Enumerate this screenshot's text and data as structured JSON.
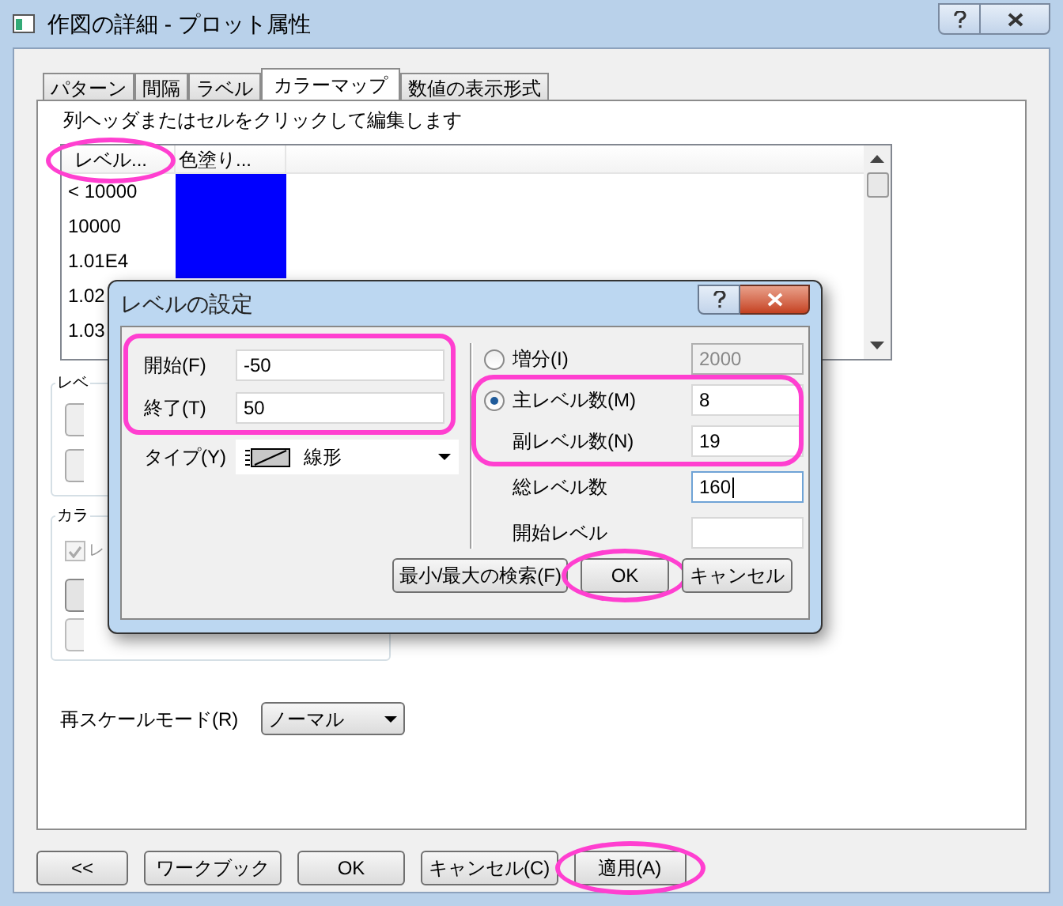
{
  "window": {
    "title": "作図の詳細 - プロット属性"
  },
  "tabs": [
    {
      "label": "パターン",
      "selected": false
    },
    {
      "label": "間隔",
      "selected": false
    },
    {
      "label": "ラベル",
      "selected": false
    },
    {
      "label": "カラーマップ",
      "selected": true
    },
    {
      "label": "数値の表示形式",
      "selected": false
    }
  ],
  "colormap": {
    "hint": "列ヘッダまたはセルをクリックして編集します",
    "columns": [
      {
        "label": "レベル...",
        "highlighted": true
      },
      {
        "label": "色塗り...",
        "highlighted": false
      }
    ],
    "rows": [
      {
        "level": "< 10000",
        "color": "#0000ff"
      },
      {
        "level": "10000",
        "color": "#0000ff"
      },
      {
        "level": "1.01E4",
        "color": "#0000ff"
      },
      {
        "level": "1.02"
      },
      {
        "level": "1.03"
      }
    ]
  },
  "level_group": {
    "label": "レベ"
  },
  "color_group": {
    "label": "カラ",
    "checkbox": {
      "label": "レ",
      "checked": true,
      "disabled": true
    }
  },
  "rescale": {
    "label": "再スケールモード(R)",
    "value": "ノーマル"
  },
  "buttons": [
    {
      "label": "<<",
      "highlighted": false
    },
    {
      "label": "ワークブック",
      "highlighted": false
    },
    {
      "label": "OK",
      "highlighted": false
    },
    {
      "label": "キャンセル(C)",
      "highlighted": false
    },
    {
      "label": "適用(A)",
      "highlighted": true
    }
  ],
  "level_dialog": {
    "title": "レベルの設定",
    "range": {
      "highlighted": true,
      "fields": [
        {
          "label": "開始(F)",
          "value": "-50"
        },
        {
          "label": "終了(T)",
          "value": "50"
        }
      ]
    },
    "type": {
      "label": "タイプ(Y)",
      "value": "線形"
    },
    "increment": {
      "label": "増分(I)",
      "selected": false,
      "value": "2000",
      "disabled": true
    },
    "level_counts": {
      "highlighted": true,
      "items": [
        {
          "kind": "radio",
          "label": "主レベル数(M)",
          "selected": true,
          "value": "8"
        },
        {
          "kind": "plain",
          "label": "副レベル数(N)",
          "value": "19"
        }
      ]
    },
    "total": {
      "label": "総レベル数",
      "value": "160",
      "focused": true
    },
    "start_level": {
      "label": "開始レベル"
    },
    "buttons": [
      {
        "label": "最小/最大の検索(F)",
        "highlighted": false
      },
      {
        "label": "OK",
        "highlighted": true
      },
      {
        "label": "キャンセル",
        "highlighted": false
      }
    ]
  }
}
